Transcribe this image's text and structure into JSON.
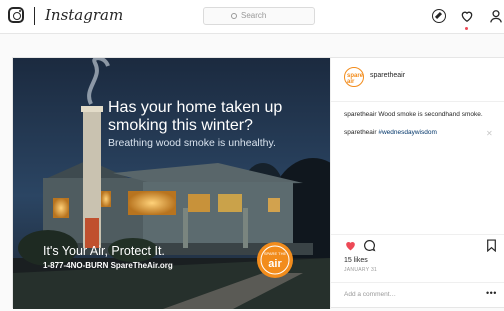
{
  "nav": {
    "brand": "Instagram",
    "search_placeholder": "Search"
  },
  "post": {
    "image": {
      "headline": "Has your home taken up smoking this winter?",
      "subhead": "Breathing wood smoke is unhealthy.",
      "slogan": "It's Your Air, Protect It.",
      "phone": "1-877-4NO-BURN SpareTheAir.org",
      "badge_small": "SPARE THE",
      "badge_big": "air"
    },
    "author": "sparetheair",
    "avatar_text": "spare air",
    "caption_user": "sparetheair",
    "caption_text": "Wood smoke is secondhand smoke.",
    "comment_user": "sparetheair",
    "comment_hashtag": "#wednesdaywisdom",
    "likes": "15 likes",
    "date": "JANUARY 31",
    "add_comment_placeholder": "Add a comment…",
    "more_label": "•••"
  },
  "colors": {
    "like_red": "#ed4956",
    "brand_orange": "#f28c1c"
  }
}
